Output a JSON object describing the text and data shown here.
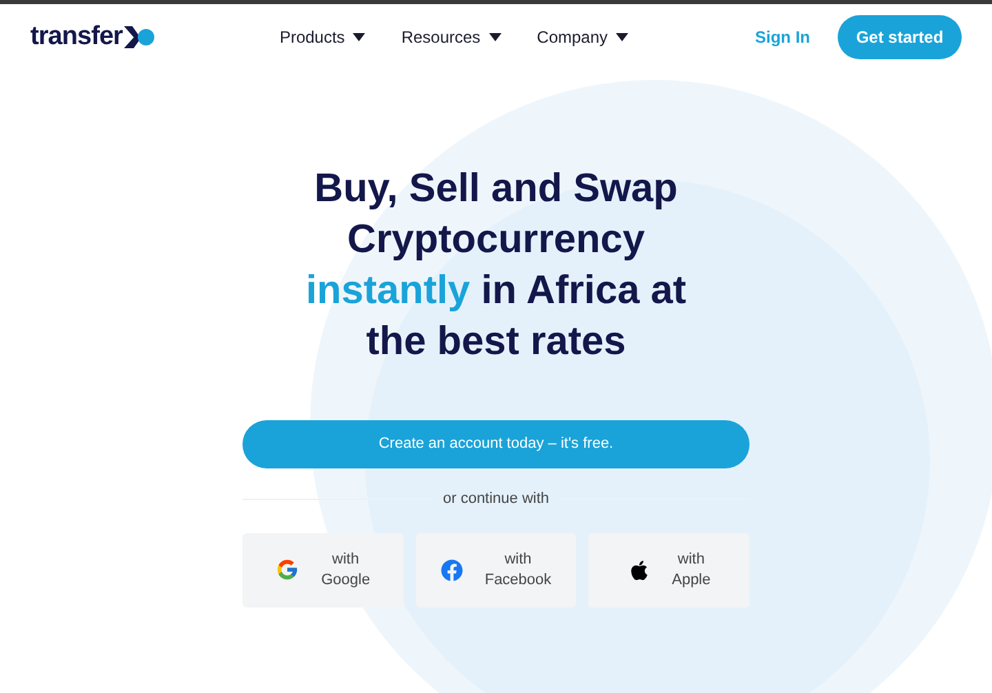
{
  "header": {
    "logo": "transfer",
    "nav": [
      {
        "label": "Products"
      },
      {
        "label": "Resources"
      },
      {
        "label": "Company"
      }
    ],
    "sign_in": "Sign In",
    "cta": "Get started"
  },
  "hero": {
    "headline": [
      {
        "text": "Buy, Sell and Swap Cryptocurrency ",
        "highlight": false
      },
      {
        "text": "instantly",
        "highlight": true
      },
      {
        "text": " in Africa at the best rates",
        "highlight": false
      }
    ],
    "primary_button": "Create an account today – it's free.",
    "divider_text": "or continue with",
    "social": [
      {
        "kind": "google",
        "label": "with Google"
      },
      {
        "kind": "facebook",
        "label": "with Facebook"
      },
      {
        "kind": "apple",
        "label": "with Apple"
      }
    ]
  }
}
